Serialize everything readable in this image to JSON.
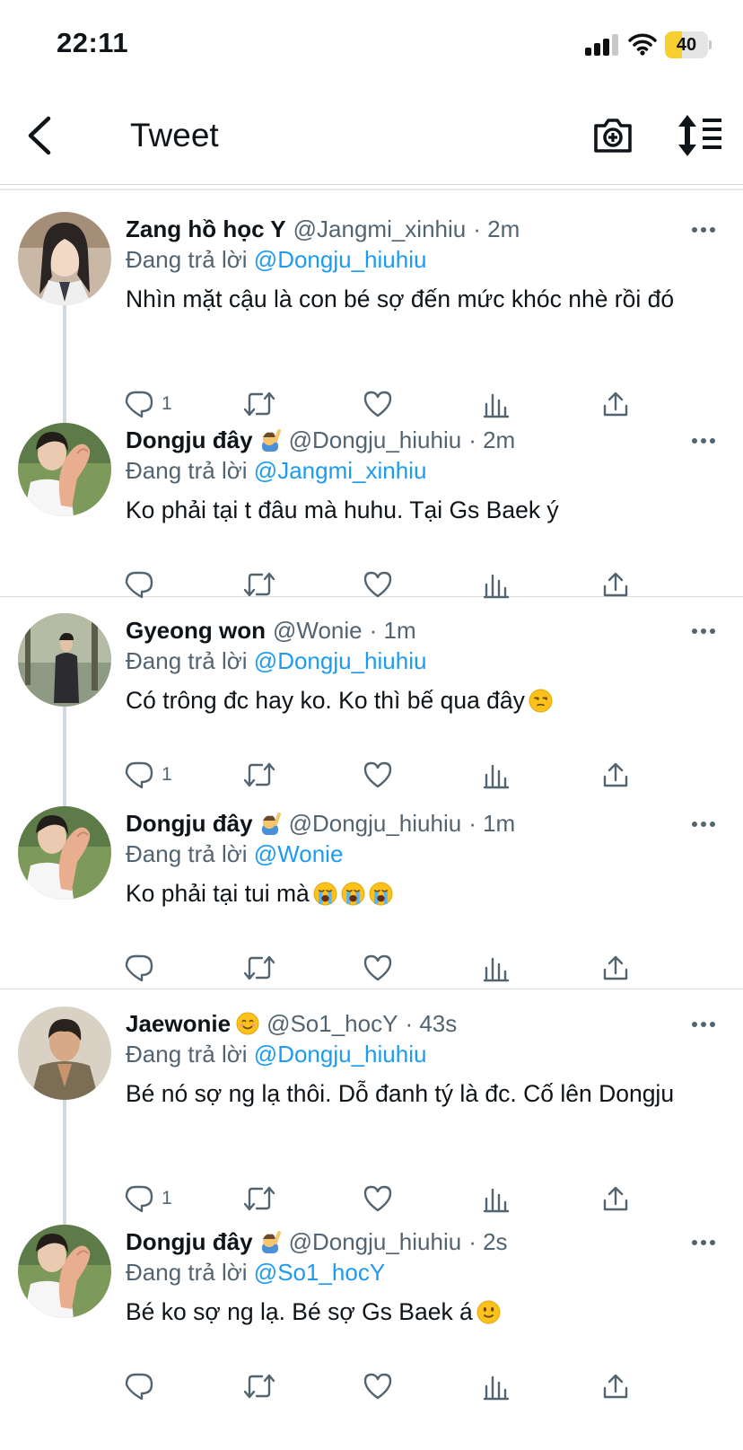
{
  "status_bar": {
    "time": "22:11",
    "battery": "40",
    "battery_level": 0.4,
    "signal_bars": 3,
    "icons": [
      "signal-icon",
      "wifi-icon",
      "battery-icon"
    ]
  },
  "header": {
    "title": "Tweet",
    "icons": [
      "back-chevron-icon",
      "camera-plus-icon",
      "sort-icon"
    ]
  },
  "colors": {
    "link": "#1d9bf0",
    "secondary_text": "#536471",
    "battery_fill": "#f7cf2e"
  },
  "tweets": [
    {
      "name": "Zang hồ học Y",
      "badge": "",
      "handle": "@Jangmi_xinhiu",
      "time": "· 2m",
      "reply_prefix": "Đang trả lời",
      "reply_to": "@Dongju_hiuhiu",
      "text": "Nhìn mặt cậu là con bé sợ đến mức khóc nhè rồi đó",
      "reply_count": "1"
    },
    {
      "name": "Dongju đây",
      "badge": "raising-hand-emoji",
      "handle": "@Dongju_hiuhiu",
      "time": "· 2m",
      "reply_prefix": "Đang trả lời",
      "reply_to": "@Jangmi_xinhiu",
      "text": "Ko phải tại t đâu mà huhu. Tại Gs Baek ý",
      "reply_count": ""
    },
    {
      "name": "Gyeong won",
      "badge": "",
      "handle": "@Wonie",
      "time": "· 1m",
      "reply_prefix": "Đang trả lời",
      "reply_to": "@Dongju_hiuhiu",
      "text": "Có trông đc hay ko. Ko thì bế qua đây",
      "text_emojis": [
        "unamused-face-emoji"
      ],
      "reply_count": "1"
    },
    {
      "name": "Dongju đây",
      "badge": "raising-hand-emoji",
      "handle": "@Dongju_hiuhiu",
      "time": "· 1m",
      "reply_prefix": "Đang trả lời",
      "reply_to": "@Wonie",
      "text": "Ko phải tại tui mà",
      "text_emojis": [
        "loudly-crying-face-emoji",
        "loudly-crying-face-emoji",
        "loudly-crying-face-emoji"
      ],
      "reply_count": ""
    },
    {
      "name": "Jaewonie",
      "badge": "smiling-face-emoji",
      "handle": "@So1_hocY",
      "time": "· 43s",
      "reply_prefix": "Đang trả lời",
      "reply_to": "@Dongju_hiuhiu",
      "text": "Bé nó sợ ng lạ thôi. Dỗ đanh tý là đc. Cố lên Dongju",
      "reply_count": "1"
    },
    {
      "name": "Dongju đây",
      "badge": "raising-hand-emoji",
      "handle": "@Dongju_hiuhiu",
      "time": "· 2s",
      "reply_prefix": "Đang trả lời",
      "reply_to": "@So1_hocY",
      "text": "Bé ko sợ ng lạ. Bé sợ Gs Baek á",
      "text_emojis": [
        "slightly-smiling-face-emoji"
      ],
      "reply_count": ""
    }
  ],
  "action_icons": [
    "reply-icon",
    "retweet-icon",
    "like-icon",
    "views-icon",
    "share-icon"
  ]
}
